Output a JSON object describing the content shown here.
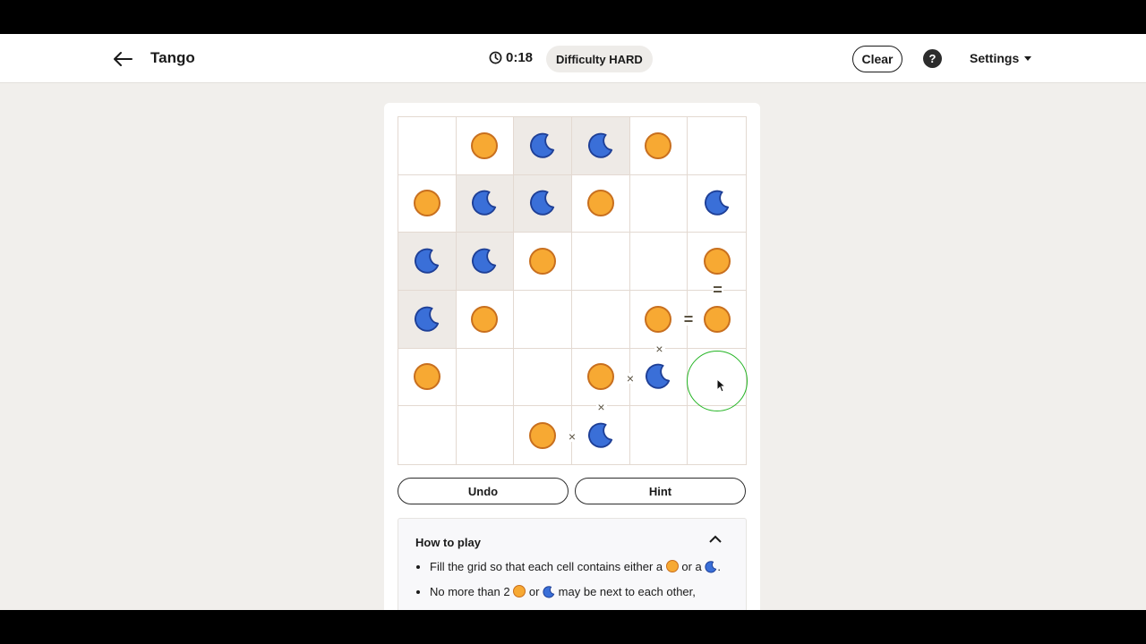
{
  "header": {
    "title": "Tango",
    "timer": "0:18",
    "difficulty": "Difficulty HARD",
    "clear_label": "Clear",
    "help_label": "?",
    "settings_label": "Settings"
  },
  "board": {
    "rows": 6,
    "cols": 6,
    "symbols": {
      "S": "sun",
      "M": "moon",
      "": "empty"
    },
    "cells": [
      [
        "",
        "S",
        "M",
        "M",
        "S",
        ""
      ],
      [
        "S",
        "M",
        "M",
        "S",
        "",
        "M"
      ],
      [
        "M",
        "M",
        "S",
        "",
        "",
        "S"
      ],
      [
        "M",
        "S",
        "",
        "",
        "S",
        "S"
      ],
      [
        "S",
        "",
        "",
        "S",
        "M",
        ""
      ],
      [
        "",
        "",
        "S",
        "M",
        "",
        ""
      ]
    ],
    "locked": [
      [
        0,
        2
      ],
      [
        0,
        3
      ],
      [
        1,
        1
      ],
      [
        1,
        2
      ],
      [
        2,
        0
      ],
      [
        2,
        1
      ],
      [
        3,
        0
      ]
    ],
    "constraints": [
      {
        "between": [
          [
            2,
            5
          ],
          [
            3,
            5
          ]
        ],
        "symbol": "="
      },
      {
        "between": [
          [
            3,
            4
          ],
          [
            3,
            5
          ]
        ],
        "symbol": "="
      },
      {
        "between": [
          [
            3,
            4
          ],
          [
            4,
            4
          ]
        ],
        "symbol": "×"
      },
      {
        "between": [
          [
            4,
            3
          ],
          [
            4,
            4
          ]
        ],
        "symbol": "×"
      },
      {
        "between": [
          [
            4,
            3
          ],
          [
            5,
            3
          ]
        ],
        "symbol": "×"
      },
      {
        "between": [
          [
            5,
            2
          ],
          [
            5,
            3
          ]
        ],
        "symbol": "×"
      }
    ],
    "colors": {
      "sun_fill": "#f7a933",
      "sun_stroke": "#c86f1e",
      "moon_fill": "#3a6fd8",
      "moon_stroke": "#1e3f96",
      "locked_bg": "#eeeae6",
      "cursor_ring": "#23b423"
    }
  },
  "actions": {
    "undo_label": "Undo",
    "hint_label": "Hint"
  },
  "how_to_play": {
    "title": "How to play",
    "rule1_pre": "Fill the grid so that each cell contains either a",
    "rule1_mid": "or a",
    "rule1_end": ".",
    "rule2_pre": "No more than 2",
    "rule2_mid": "or",
    "rule2_end": "may be next to each other,"
  }
}
